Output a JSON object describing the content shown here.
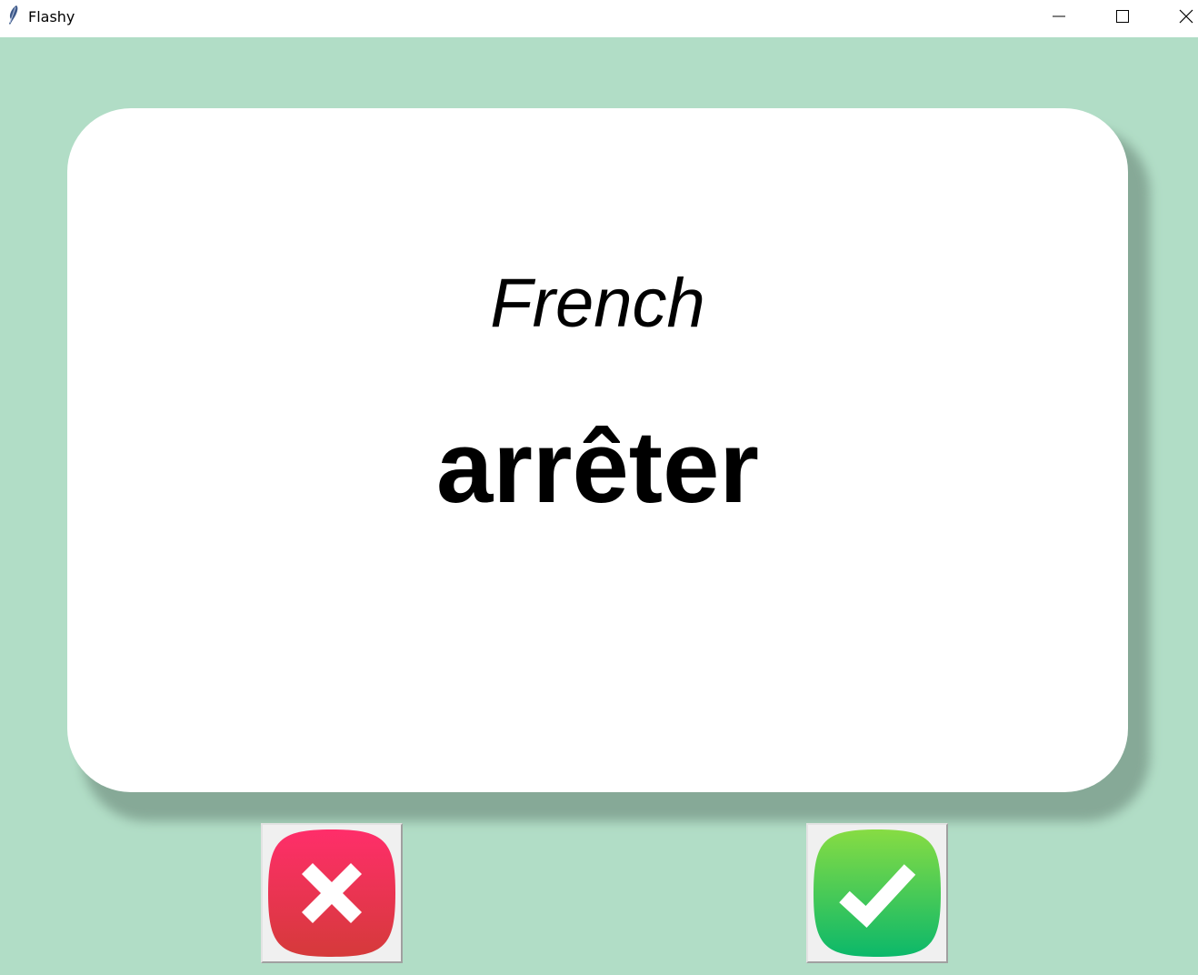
{
  "window": {
    "title": "Flashy"
  },
  "card": {
    "title": "French",
    "word": "arrêter"
  },
  "buttons": {
    "wrong": {
      "icon": "cross-icon",
      "color": "#e8334f"
    },
    "right": {
      "icon": "checkmark-icon",
      "color": "#2ec85e"
    }
  },
  "colors": {
    "background": "#b1ddc6",
    "card": "#ffffff"
  }
}
